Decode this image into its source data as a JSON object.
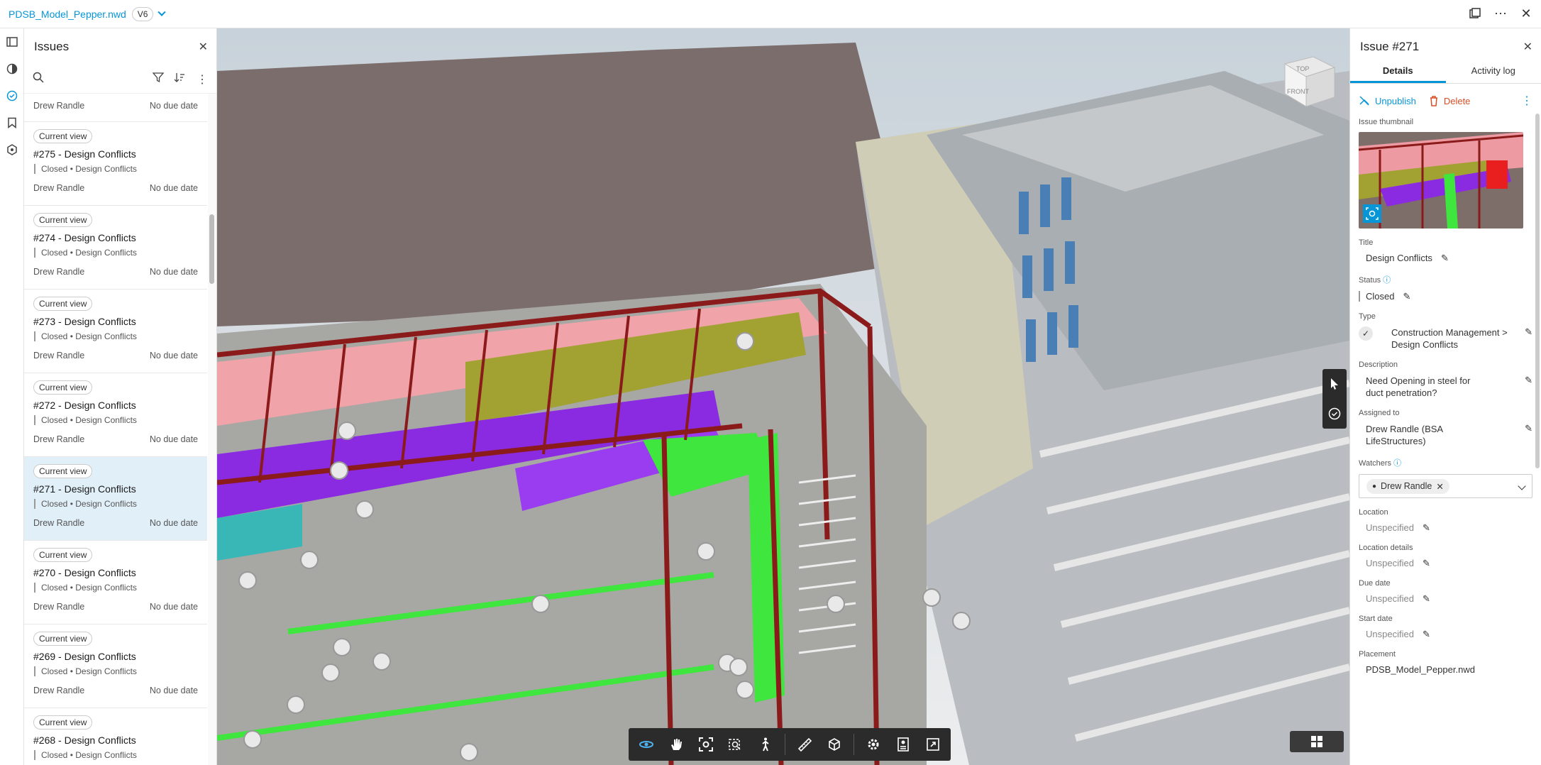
{
  "topbar": {
    "filename": "PDSB_Model_Pepper.nwd",
    "version": "V6"
  },
  "left_panel": {
    "title": "Issues",
    "top_partial": {
      "assignee": "Drew Randle",
      "due": "No due date"
    },
    "issues": [
      {
        "chip": "Current view",
        "title": "#275 - Design Conflicts",
        "status": "Closed • Design Conflicts",
        "assignee": "Drew Randle",
        "due": "No due date"
      },
      {
        "chip": "Current view",
        "title": "#274 - Design Conflicts",
        "status": "Closed • Design Conflicts",
        "assignee": "Drew Randle",
        "due": "No due date"
      },
      {
        "chip": "Current view",
        "title": "#273 - Design Conflicts",
        "status": "Closed • Design Conflicts",
        "assignee": "Drew Randle",
        "due": "No due date"
      },
      {
        "chip": "Current view",
        "title": "#272 - Design Conflicts",
        "status": "Closed • Design Conflicts",
        "assignee": "Drew Randle",
        "due": "No due date"
      },
      {
        "chip": "Current view",
        "title": "#271 - Design Conflicts",
        "status": "Closed • Design Conflicts",
        "assignee": "Drew Randle",
        "due": "No due date"
      },
      {
        "chip": "Current view",
        "title": "#270 - Design Conflicts",
        "status": "Closed • Design Conflicts",
        "assignee": "Drew Randle",
        "due": "No due date"
      },
      {
        "chip": "Current view",
        "title": "#269 - Design Conflicts",
        "status": "Closed • Design Conflicts",
        "assignee": "Drew Randle",
        "due": "No due date"
      },
      {
        "chip": "Current view",
        "title": "#268 - Design Conflicts",
        "status": "Closed • Design Conflicts",
        "assignee": "",
        "due": ""
      }
    ]
  },
  "viewcube": {
    "top": "TOP",
    "front": "FRONT"
  },
  "right_panel": {
    "title": "Issue #271",
    "tabs": [
      "Details",
      "Activity log"
    ],
    "unpublish": "Unpublish",
    "delete": "Delete",
    "thumbnail_label": "Issue thumbnail",
    "title_label": "Title",
    "title_value": "Design Conflicts",
    "status_label": "Status",
    "status_value": "Closed",
    "type_label": "Type",
    "type_value": "Construction Management > Design Conflicts",
    "description_label": "Description",
    "description_value": "Need Opening in steel for duct penetration?",
    "assigned_label": "Assigned to",
    "assigned_value": "Drew Randle (BSA LifeStructures)",
    "watchers_label": "Watchers",
    "watcher": "Drew Randle",
    "location_label": "Location",
    "location_value": "Unspecified",
    "location_details_label": "Location details",
    "location_details_value": "Unspecified",
    "due_label": "Due date",
    "due_value": "Unspecified",
    "start_label": "Start date",
    "start_value": "Unspecified",
    "placement_label": "Placement",
    "placement_value": "PDSB_Model_Pepper.nwd"
  },
  "colors": {
    "accent": "#0696d7",
    "delete": "#d74e26",
    "selected_row": "#e1eff8"
  }
}
